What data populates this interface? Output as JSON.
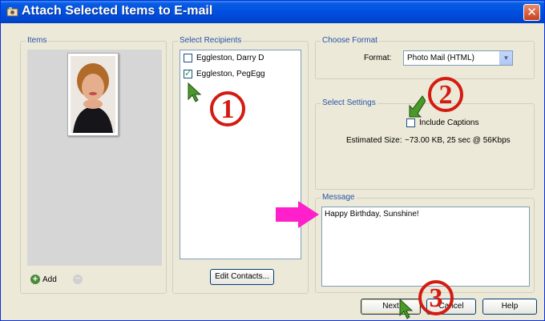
{
  "window": {
    "title": "Attach Selected Items to E-mail",
    "close_glyph": "✕"
  },
  "items": {
    "label": "Items",
    "add_label": "Add",
    "add_glyph": "+",
    "remove_glyph": "−"
  },
  "recipients": {
    "label": "Select Recipients",
    "list": [
      {
        "name": "Eggleston, Darry D",
        "checked": false
      },
      {
        "name": "Eggleston, PegEgg",
        "checked": true
      }
    ],
    "edit_label": "Edit Contacts..."
  },
  "format": {
    "label": "Choose Format",
    "field_label": "Format:",
    "selected": "Photo Mail (HTML)"
  },
  "settings": {
    "label": "Select Settings",
    "caption_label": "Include Captions",
    "caption_checked": false,
    "est_label": "Estimated Size:",
    "est_value": "~73.00 KB, 25 sec @ 56Kbps"
  },
  "message": {
    "label": "Message",
    "text": "Happy Birthday, Sunshine!"
  },
  "buttons": {
    "next": "Next",
    "cancel": "Cancel",
    "help": "Help"
  },
  "annotations": {
    "one": "1",
    "two": "2",
    "three": "3"
  },
  "colors": {
    "title_bar": "#0050e0",
    "annotation_red": "#d31b12",
    "arrow_green": "#4a9a2a",
    "arrow_magenta": "#ff1fcb"
  }
}
